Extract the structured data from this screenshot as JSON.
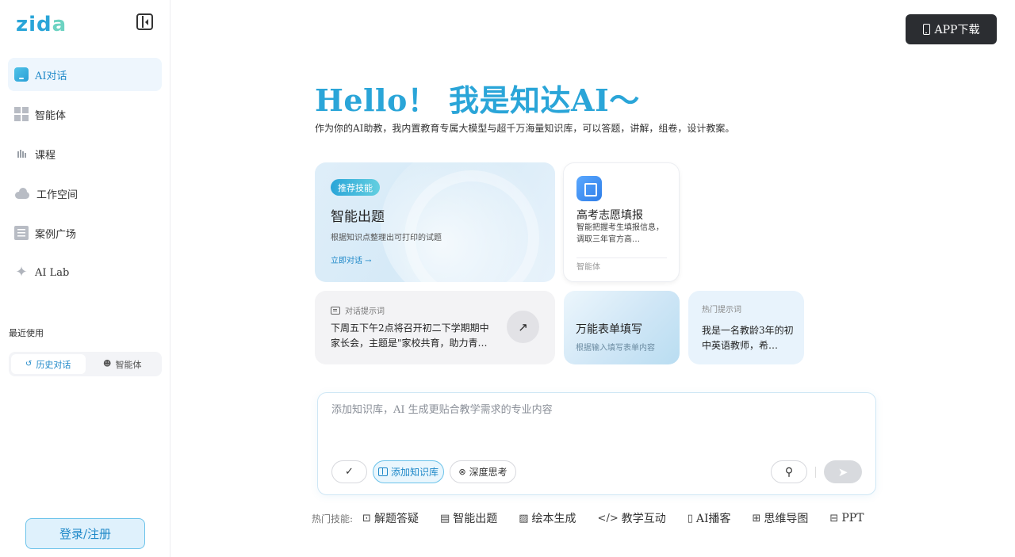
{
  "logo": {
    "text_main": "zid",
    "text_accent": "a"
  },
  "sidebar": {
    "items": [
      {
        "label": "AI对话",
        "icon": "chat-bubble-icon",
        "active": true
      },
      {
        "label": "智能体",
        "icon": "grid-icon",
        "active": false
      },
      {
        "label": "课程",
        "icon": "course-icon",
        "active": false
      },
      {
        "label": "工作空间",
        "icon": "cloud-icon",
        "active": false
      },
      {
        "label": "案例广场",
        "icon": "list-icon",
        "active": false
      },
      {
        "label": "AI Lab",
        "icon": "sparkle-icon",
        "active": false
      }
    ],
    "recent_title": "最近使用",
    "recent_tabs": [
      {
        "label": "历史对话",
        "icon": "history-icon",
        "active": true
      },
      {
        "label": "智能体",
        "icon": "bot-icon",
        "active": false
      }
    ],
    "login_label": "登录/注册"
  },
  "header": {
    "app_download": "APP下载"
  },
  "hero": {
    "title": "Hello！ 我是知达AI～",
    "subtitle": "作为你的AI助教，我内置教育专属大模型与超千万海量知识库，可以答题，讲解，组卷，设计教案。"
  },
  "cards": {
    "main": {
      "tag": "推荐技能",
      "title": "智能出题",
      "desc": "根据知识点整理出可打印的试题",
      "link": "立即对话 →"
    },
    "gaokao": {
      "title": "高考志愿填报",
      "desc": "智能把握考生填报信息，调取三年官方高…",
      "footer": "智能体"
    },
    "prompt": {
      "head": "对话提示词",
      "body": "下周五下午2点将召开初二下学期期中家长会，主题是\"家校共育，助力青…",
      "arrow": "↗"
    },
    "form": {
      "title": "万能表单填写",
      "desc": "根据输入填写表单内容"
    },
    "hot": {
      "head": "热门提示词",
      "body": "我是一名教龄3年的初中英语教师，希…"
    }
  },
  "input": {
    "placeholder": "添加知识库，AI 生成更贴合教学需求的专业内容",
    "check_label": "✓",
    "kb_label": "添加知识库",
    "think_label": "深度思考",
    "attach": "⚲",
    "send": "➤"
  },
  "skills": {
    "label": "热门技能:",
    "items": [
      {
        "icon": "⊡",
        "label": "解题答疑"
      },
      {
        "icon": "▤",
        "label": "智能出题"
      },
      {
        "icon": "▨",
        "label": "绘本生成"
      },
      {
        "icon": "</>",
        "label": "教学互动"
      },
      {
        "icon": "▯",
        "label": "AI播客"
      },
      {
        "icon": "⊞",
        "label": "思维导图"
      },
      {
        "icon": "⊟",
        "label": "PPT"
      }
    ]
  },
  "colors": {
    "accent": "#2aa5d8",
    "accent_light": "#dff1fc",
    "dark_button": "#2b2d31"
  }
}
